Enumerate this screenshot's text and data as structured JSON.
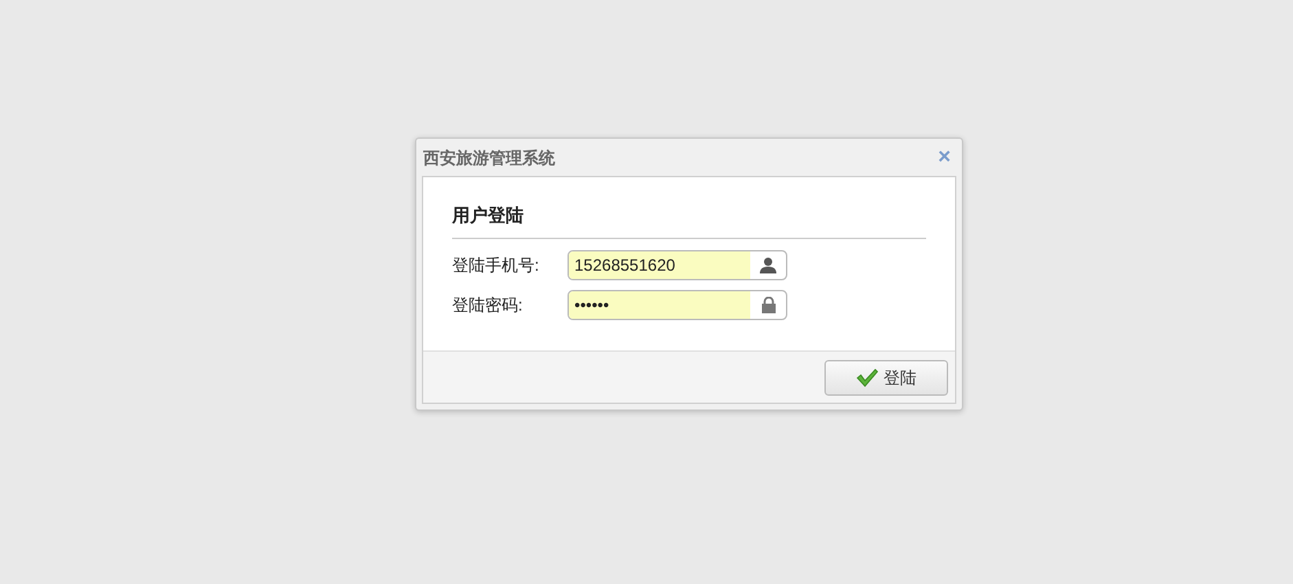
{
  "window": {
    "title": "西安旅游管理系统",
    "close": "×"
  },
  "section_title": "用户登陆",
  "fields": [
    {
      "label": "登陆手机号:",
      "value": "15268551620",
      "kind": "user"
    },
    {
      "label": "登陆密码:",
      "value": "••••••",
      "kind": "lock"
    }
  ],
  "button": {
    "label": "登陆"
  }
}
